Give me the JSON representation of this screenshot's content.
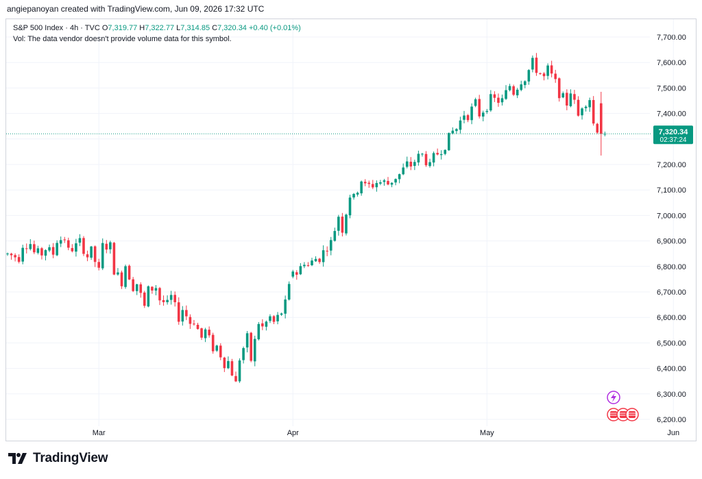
{
  "credit": "angiepanoyan created with TradingView.com, Jun 09, 2026 17:32 UTC",
  "legend": {
    "symbol": "S&P 500 Index · 4h · TVC",
    "open_label": "O",
    "open": "7,319.77",
    "high_label": "H",
    "high": "7,322.77",
    "low_label": "L",
    "low": "7,314.85",
    "close_label": "C",
    "close": "7,320.34",
    "change": "+0.40 (+0.01%)",
    "volume_note": "Vol: The data vendor doesn't provide volume data for this symbol."
  },
  "price_label": {
    "price": "7,320.34",
    "countdown": "02:37:24"
  },
  "brand": {
    "name": "TradingView",
    "logo_icon": "tradingview-logo-icon"
  },
  "icons": [
    "lightning-icon",
    "us-flag-icon",
    "us-flag-icon",
    "us-flag-icon"
  ],
  "colors": {
    "up": "#089981",
    "down": "#f23645",
    "grid": "#f0f3fa",
    "axis_text": "#131722",
    "price_label_bg": "#089981",
    "event_icon": "#b02ee0",
    "flag": "#f23645"
  },
  "chart_data": {
    "type": "candlestick",
    "title": "S&P 500 Index · 4h · TVC",
    "ylim": [
      6180,
      7740
    ],
    "y_ticks": [
      "7,700.00",
      "7,600.00",
      "7,500.00",
      "7,400.00",
      "7,300.00",
      "7,200.00",
      "7,100.00",
      "7,000.00",
      "6,900.00",
      "6,800.00",
      "6,700.00",
      "6,600.00",
      "6,500.00",
      "6,400.00",
      "6,300.00",
      "6,200.00"
    ],
    "x_tick_labels": [
      {
        "label": "Mar",
        "bar": 24
      },
      {
        "label": "Apr",
        "bar": 75
      },
      {
        "label": "May",
        "bar": 126
      },
      {
        "label": "Jun",
        "bar": 175
      }
    ],
    "last_price": 7320.34,
    "grid": true,
    "ohlc_points": [
      [
        0,
        6848,
        6885
      ],
      [
        3,
        6885,
        6835
      ],
      [
        6,
        6855,
        6890
      ],
      [
        9,
        6880,
        6850
      ],
      [
        12,
        6900,
        6850
      ],
      [
        15,
        6850,
        6910
      ],
      [
        18,
        6925,
        6880
      ],
      [
        21,
        6900,
        6840
      ],
      [
        24,
        6880,
        6780
      ],
      [
        27,
        6810,
        6880
      ],
      [
        30,
        6850,
        6740
      ],
      [
        33,
        6780,
        6720
      ],
      [
        36,
        6700,
        6640
      ],
      [
        39,
        6680,
        6720
      ],
      [
        42,
        6720,
        6650
      ],
      [
        45,
        6660,
        6600
      ],
      [
        48,
        6620,
        6580
      ],
      [
        51,
        6580,
        6520
      ],
      [
        54,
        6520,
        6480
      ],
      [
        57,
        6470,
        6420
      ],
      [
        60,
        6400,
        6340
      ],
      [
        63,
        6360,
        6520
      ],
      [
        66,
        6540,
        6580
      ],
      [
        69,
        6560,
        6600
      ],
      [
        72,
        6590,
        6620
      ],
      [
        75,
        6750,
        6780
      ],
      [
        78,
        6790,
        6820
      ],
      [
        81,
        6810,
        6830
      ],
      [
        84,
        6840,
        6880
      ],
      [
        87,
        6880,
        7000
      ],
      [
        90,
        7030,
        7080
      ],
      [
        93,
        7110,
        7140
      ],
      [
        96,
        7130,
        7120
      ],
      [
        99,
        7110,
        7130
      ],
      [
        102,
        7140,
        7150
      ],
      [
        105,
        7180,
        7200
      ],
      [
        108,
        7260,
        7230
      ],
      [
        111,
        7210,
        7190
      ],
      [
        114,
        7250,
        7260
      ],
      [
        117,
        7310,
        7330
      ],
      [
        120,
        7370,
        7400
      ],
      [
        123,
        7380,
        7440
      ],
      [
        126,
        7460,
        7430
      ],
      [
        129,
        7420,
        7450
      ],
      [
        132,
        7460,
        7510
      ],
      [
        135,
        7510,
        7530
      ],
      [
        138,
        7590,
        7600
      ],
      [
        141,
        7600,
        7540
      ],
      [
        144,
        7500,
        7520
      ],
      [
        147,
        7540,
        7440
      ],
      [
        150,
        7420,
        7390
      ],
      [
        153,
        7380,
        7460
      ],
      [
        156,
        7460,
        7320
      ]
    ],
    "ohlc_note": "[bar_index, open, close] checkpoints"
  }
}
